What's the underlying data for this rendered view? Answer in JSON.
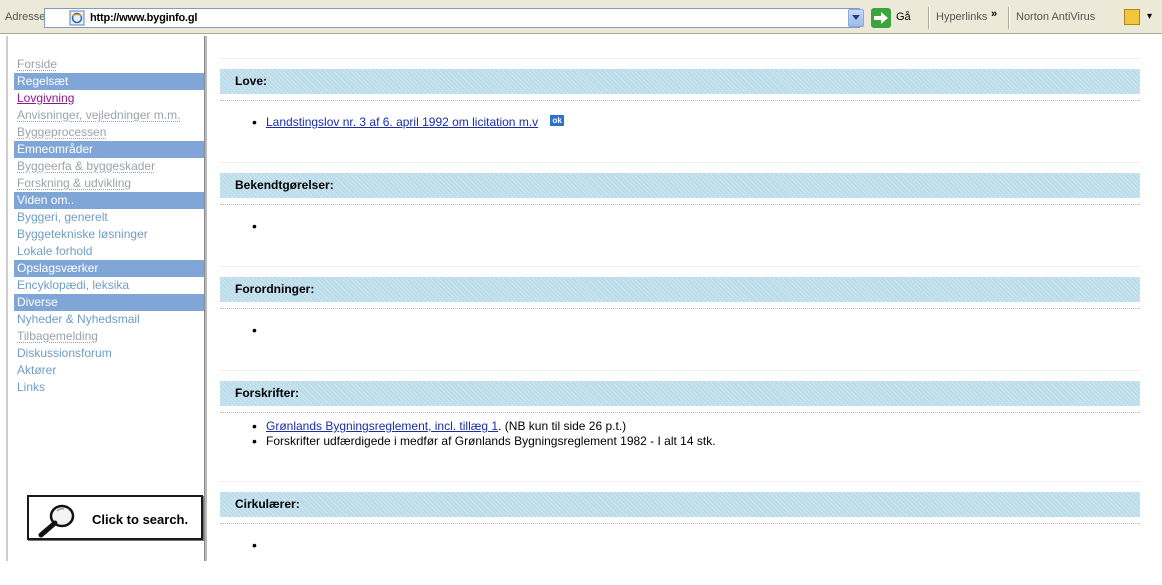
{
  "browser": {
    "address_label": "Adresse",
    "url": "http://www.byginfo.gl",
    "go_label": "Gå",
    "links_label": "Hyperlinks",
    "links_chevron": "»",
    "toolbar_item": "Norton AntiVirus"
  },
  "sidebar": {
    "items": [
      {
        "label": "Forside",
        "kind": "dotted"
      },
      {
        "label": "Regelsæt",
        "kind": "header"
      },
      {
        "label": "Lovgivning",
        "kind": "visited"
      },
      {
        "label": "Anvisninger, vejledninger m.m.",
        "kind": "dotted"
      },
      {
        "label": "Byggeprocessen",
        "kind": "dotted"
      },
      {
        "label": "Emneområder",
        "kind": "header"
      },
      {
        "label": "Byggeerfa & byggeskader",
        "kind": "dotted"
      },
      {
        "label": "Forskning & udvikling",
        "kind": "dotted"
      },
      {
        "label": "Viden om..",
        "kind": "header"
      },
      {
        "label": "Byggeri, generelt",
        "kind": "plain"
      },
      {
        "label": "Byggetekniske løsninger",
        "kind": "plain"
      },
      {
        "label": "Lokale forhold",
        "kind": "plain"
      },
      {
        "label": "Opslagsværker",
        "kind": "header"
      },
      {
        "label": "Encyklopædi, leksika",
        "kind": "plain"
      },
      {
        "label": "Diverse",
        "kind": "header"
      },
      {
        "label": "Nyheder & Nyhedsmail",
        "kind": "plain"
      },
      {
        "label": "Tilbagemelding",
        "kind": "dotted"
      },
      {
        "label": "Diskussionsforum",
        "kind": "plain"
      },
      {
        "label": "Aktører",
        "kind": "plain"
      },
      {
        "label": "Links",
        "kind": "plain"
      }
    ],
    "search_label": "Click to search."
  },
  "main": {
    "sections": [
      {
        "title": "Love:",
        "items": [
          {
            "link": "Landstingslov nr. 3 af 6. april 1992 om licitation m.v",
            "suffix": "",
            "badge": "ok"
          }
        ]
      },
      {
        "title": "Bekendtgørelser:",
        "items": [
          {
            "link": "",
            "suffix": "",
            "badge": ""
          }
        ]
      },
      {
        "title": "Forordninger:",
        "items": [
          {
            "link": "",
            "suffix": "",
            "badge": ""
          }
        ]
      },
      {
        "title": "Forskrifter:",
        "items": [
          {
            "link": "Grønlands Bygningsreglement, incl. tillæg 1",
            "suffix": ". (NB kun til side 26 p.t.)",
            "badge": ""
          },
          {
            "link": "",
            "suffix": "Forskrifter udfærdigede i medfør af Grønlands Bygningsreglement 1982 - I alt 14 stk.",
            "badge": ""
          }
        ]
      },
      {
        "title": "Cirkulærer:",
        "items": [
          {
            "link": "",
            "suffix": "",
            "badge": ""
          }
        ]
      }
    ]
  },
  "colors": {
    "section_bg": "#b9dbea",
    "nav_header_bg": "#7fa6d7",
    "link": "#1a2ea6",
    "visited": "#8b1a8b"
  }
}
